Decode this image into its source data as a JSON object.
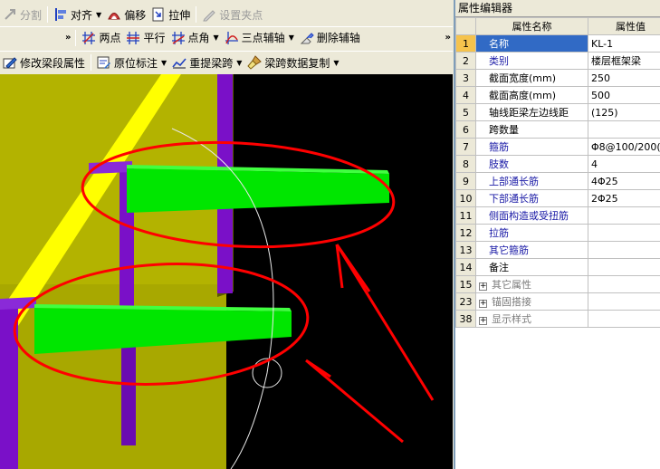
{
  "toolbar1": {
    "split": "分割",
    "align": "对齐",
    "offset": "偏移",
    "stretch": "拉伸",
    "set_grip": "设置夹点"
  },
  "toolbar2": {
    "two_points": "两点",
    "parallel": "平行",
    "point_angle": "点角",
    "three_point_aux": "三点辅轴",
    "delete_aux": "删除辅轴"
  },
  "toolbar3": {
    "modify_span": "修改梁段属性",
    "in_situ_mark": "原位标注",
    "reextract_span": "重提梁跨",
    "copy_span_data": "梁跨数据复制"
  },
  "panel": {
    "title": "属性编辑器",
    "col_name": "属性名称",
    "col_value": "属性值",
    "rows": [
      {
        "num": "1",
        "name": "名称",
        "value": "KL-1"
      },
      {
        "num": "2",
        "name": "类别",
        "value": "楼层框架梁"
      },
      {
        "num": "3",
        "name": "截面宽度(mm)",
        "value": "250"
      },
      {
        "num": "4",
        "name": "截面高度(mm)",
        "value": "500"
      },
      {
        "num": "5",
        "name": "轴线距梁左边线距",
        "value": "(125)"
      },
      {
        "num": "6",
        "name": "跨数量",
        "value": ""
      },
      {
        "num": "7",
        "name": "箍筋",
        "value": "Φ8@100/200(4"
      },
      {
        "num": "8",
        "name": "肢数",
        "value": "4"
      },
      {
        "num": "9",
        "name": "上部通长筋",
        "value": "4Φ25"
      },
      {
        "num": "10",
        "name": "下部通长筋",
        "value": "2Φ25"
      },
      {
        "num": "11",
        "name": "侧面构造或受扭筋",
        "value": ""
      },
      {
        "num": "12",
        "name": "拉筋",
        "value": ""
      },
      {
        "num": "13",
        "name": "其它箍筋",
        "value": ""
      },
      {
        "num": "14",
        "name": "备注",
        "value": ""
      },
      {
        "num": "15",
        "name": "其它属性",
        "value": ""
      },
      {
        "num": "23",
        "name": "锚固搭接",
        "value": ""
      },
      {
        "num": "38",
        "name": "显示样式",
        "value": ""
      }
    ]
  },
  "colors": {
    "beam_green": "#00e600",
    "column_purple": "#7a10c8",
    "wall_yellow": "#b3b300",
    "annotation_red": "#ff0000",
    "selection_blue": "#316ac5"
  }
}
